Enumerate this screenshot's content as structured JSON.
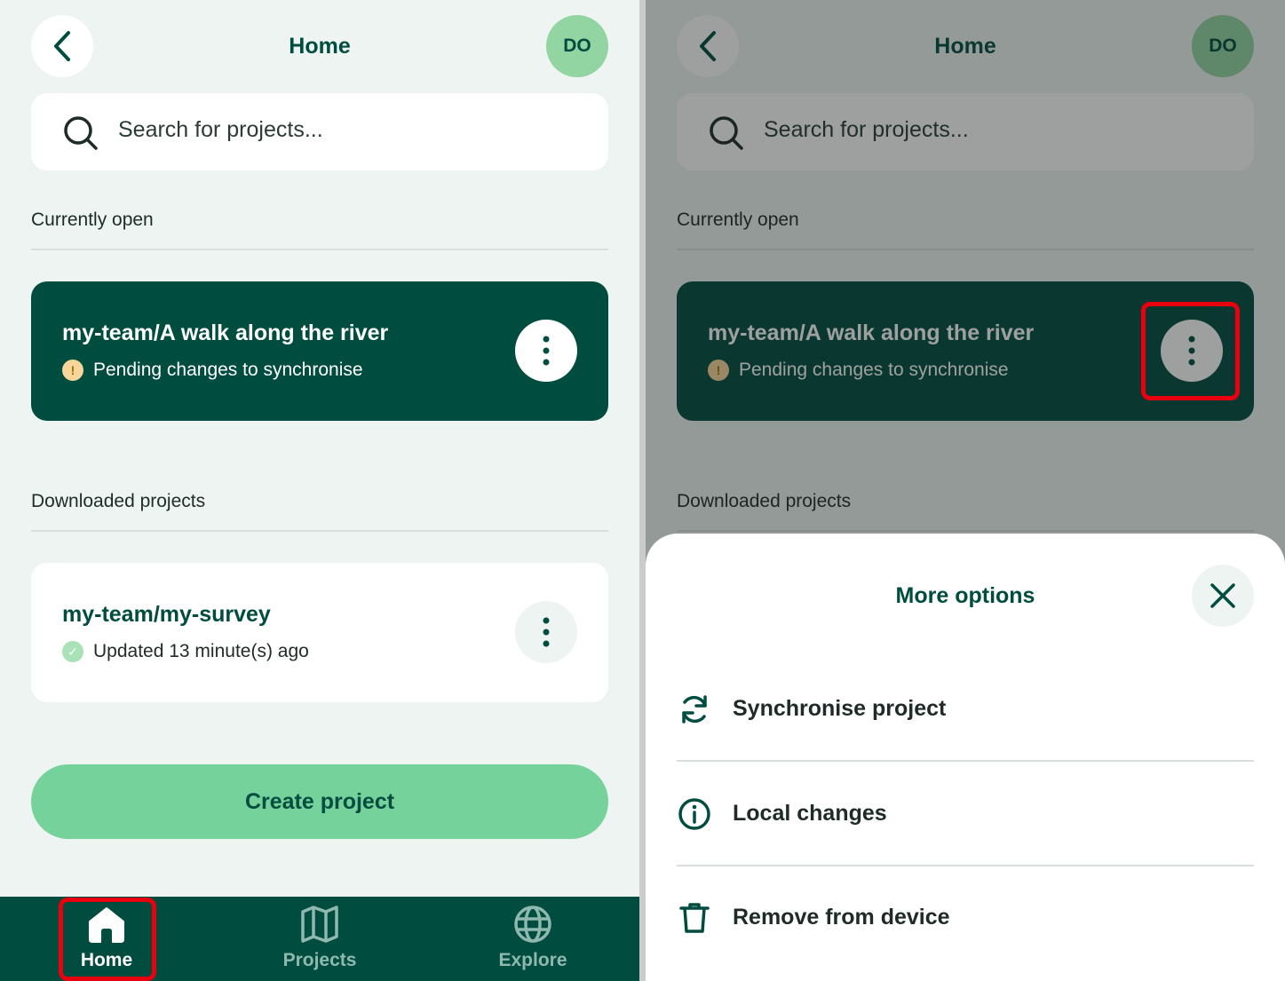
{
  "header": {
    "title": "Home",
    "avatar_initials": "DO"
  },
  "search": {
    "placeholder": "Search for projects..."
  },
  "sections": {
    "currently_open": "Currently open",
    "downloaded": "Downloaded projects"
  },
  "open_project": {
    "title": "my-team/A walk along the river",
    "status": "Pending changes to synchronise",
    "status_icon": "warning-icon"
  },
  "downloaded_project": {
    "title": "my-team/my-survey",
    "status": "Updated 13 minute(s) ago",
    "status_icon": "check-icon"
  },
  "create_button": "Create project",
  "tabs": [
    {
      "label": "Home",
      "icon": "home-icon",
      "active": true
    },
    {
      "label": "Projects",
      "icon": "map-icon",
      "active": false
    },
    {
      "label": "Explore",
      "icon": "globe-icon",
      "active": false
    }
  ],
  "sheet": {
    "title": "More options",
    "options": [
      {
        "label": "Synchronise project",
        "icon": "sync-icon"
      },
      {
        "label": "Local changes",
        "icon": "info-icon"
      },
      {
        "label": "Remove from device",
        "icon": "trash-icon"
      }
    ]
  },
  "colors": {
    "primary": "#004d40",
    "accent": "#75d29b",
    "background": "#eef4f1",
    "highlight": "#e8000e"
  }
}
